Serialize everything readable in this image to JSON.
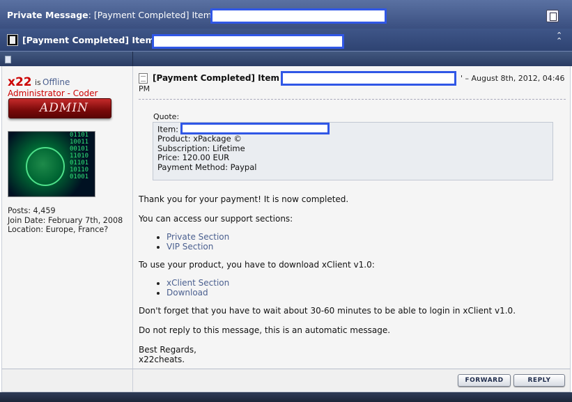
{
  "header": {
    "label": "Private Message",
    "title": ": [Payment Completed] Item",
    "icon": "private-message-icon"
  },
  "subheader": {
    "title": "[Payment Completed] Item '",
    "icon": "document-icon",
    "collapse_icon": "collapse-up-icon"
  },
  "user": {
    "name": "x22",
    "is_label": "is",
    "status": "Offline",
    "title": "Administrator - Coder",
    "badge": "ADMIN",
    "stats": {
      "posts": "Posts: 4,459",
      "join_date": "Join Date: February 7th, 2008",
      "location": "Location: Europe, France?"
    }
  },
  "message": {
    "title": "[Payment Completed] Item '",
    "date_a": "' – August 8th, 2012, 04:46",
    "date_b": "PM",
    "quote_label": "Quote:",
    "quote": {
      "item_label": "Item:",
      "product": "Product: xPackage ©",
      "subscription": "Subscription: Lifetime",
      "price": "Price: 120.00 EUR",
      "payment_method": "Payment Method: Paypal"
    },
    "thanks": "Thank you for your payment! It is now completed.",
    "access": "You can access our support sections:",
    "support_links": [
      "Private Section",
      "VIP Section"
    ],
    "use_product": "To use your product, you have to download xClient v1.0:",
    "client_links": [
      "xClient Section",
      "Download"
    ],
    "wait": "Don't forget that you have to wait about 30-60 minutes to be able to login in xClient v1.0.",
    "noreply": "Do not reply to this message, this is an automatic message.",
    "regards": "Best Regards,",
    "signature": "x22cheats."
  },
  "buttons": {
    "forward": "FORWARD",
    "reply": "REPLY"
  },
  "colors": {
    "header_bg": "#4a5f91",
    "username": "#cc0000",
    "link": "#4a5f8f",
    "redaction": "#3057e6"
  }
}
